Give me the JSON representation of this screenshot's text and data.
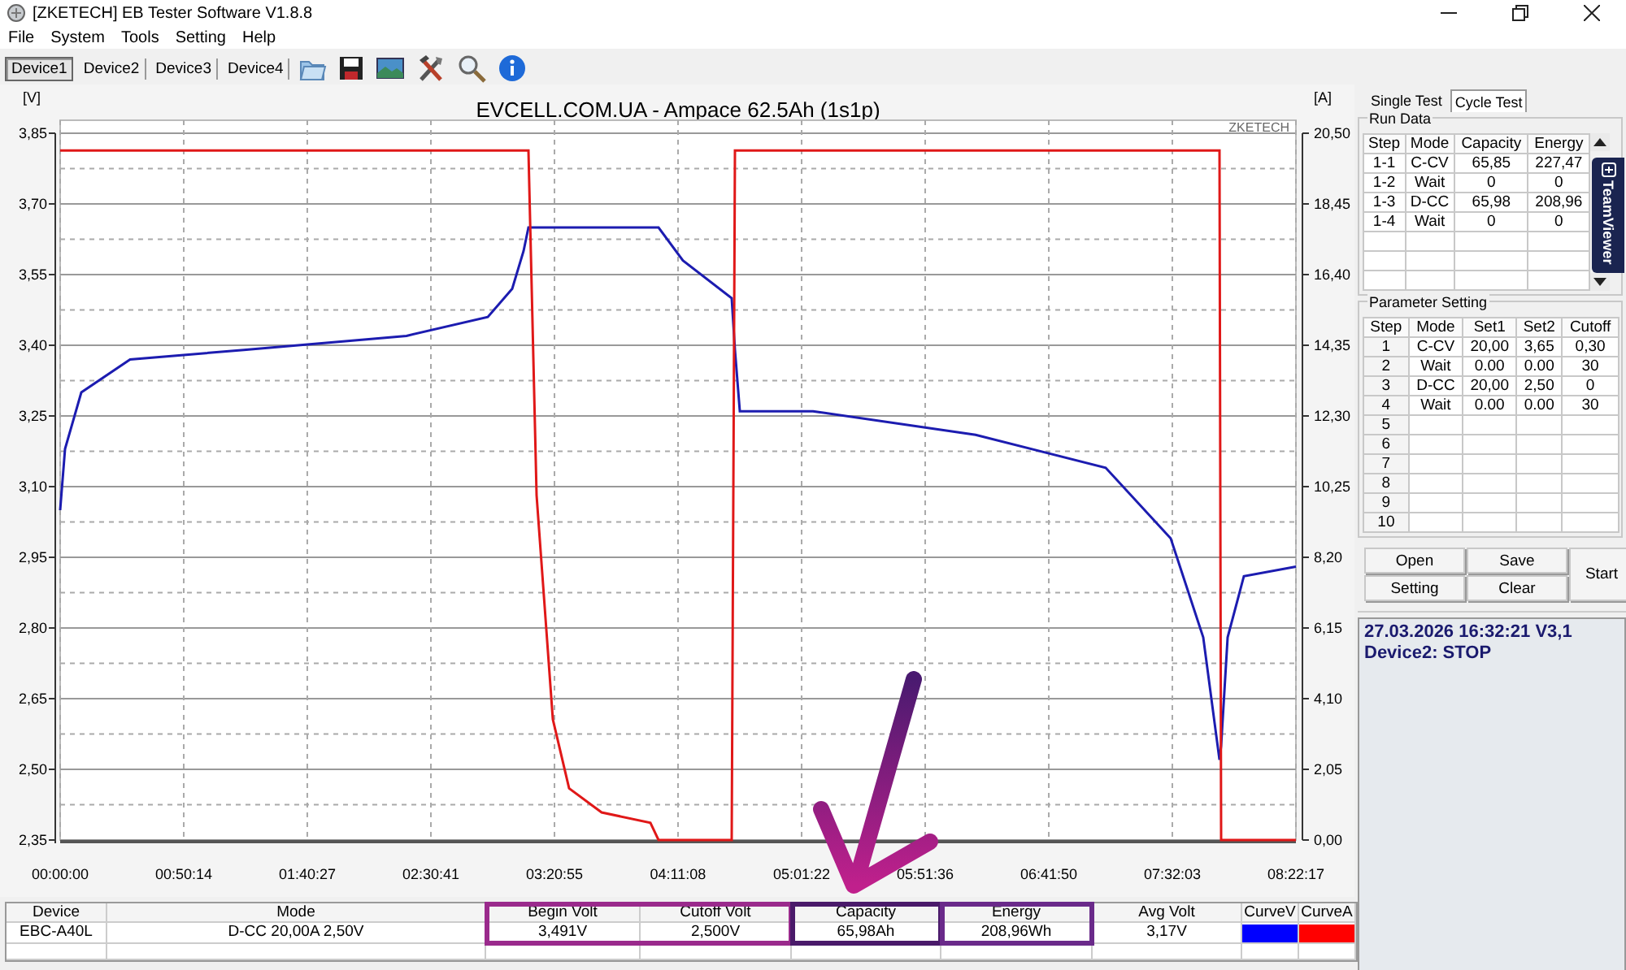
{
  "window": {
    "title": "[ZKETECH] EB Tester Software V1.8.8"
  },
  "menu": [
    "File",
    "System",
    "Tools",
    "Setting",
    "Help"
  ],
  "device_tabs": [
    {
      "label": "Device1",
      "selected": true
    },
    {
      "label": "Device2",
      "selected": false
    },
    {
      "label": "Device3",
      "selected": false
    },
    {
      "label": "Device4",
      "selected": false
    }
  ],
  "toolbar": [
    {
      "kind": "folder"
    },
    {
      "kind": "save"
    },
    {
      "kind": "image"
    },
    {
      "kind": "tools"
    },
    {
      "kind": "search"
    },
    {
      "kind": "info"
    }
  ],
  "chart": {
    "brand_label": "ZKETECH",
    "chart_data": {
      "type": "line",
      "title": "EVCELL.COM.UA - Ampace 62.5Ah (1s1p)",
      "ylabel": "[V]",
      "y2label": "[A]",
      "x": [
        0,
        119,
        516,
        1705,
        4481,
        8446,
        10429,
        11024,
        11301,
        11420,
        11619,
        12015,
        12412,
        13205,
        14394,
        14593,
        15188,
        16377,
        16456,
        16575,
        18360,
        22325,
        25497,
        27084,
        27877,
        28273,
        28313,
        28472,
        28868,
        30137
      ],
      "series": [
        {
          "color": "#1c1cb0",
          "values": [
            3.05,
            3.18,
            3.3,
            3.37,
            3.39,
            3.42,
            3.46,
            3.52,
            3.6,
            3.65,
            3.65,
            3.65,
            3.65,
            3.65,
            3.65,
            3.65,
            3.58,
            3.5,
            3.39,
            3.26,
            3.26,
            3.21,
            3.14,
            2.99,
            2.78,
            2.52,
            2.55,
            2.78,
            2.91,
            2.93
          ]
        },
        {
          "color": "#e01818",
          "axis": "y2",
          "values": [
            20.0,
            20.0,
            20.0,
            20.0,
            20.0,
            20.0,
            20.0,
            20.0,
            20.0,
            20.0,
            10.0,
            3.5,
            1.5,
            0.8,
            0.5,
            0.0,
            0.0,
            0.0,
            20.0,
            20.0,
            20.0,
            20.0,
            20.0,
            20.0,
            20.0,
            20.0,
            0.0,
            0.0,
            0.0,
            0.0
          ]
        }
      ],
      "grid": true,
      "xlim": [
        0,
        30137
      ],
      "ylim": [
        2.35,
        3.85
      ],
      "y2lim": [
        0,
        20.5
      ],
      "xticks": [
        {
          "value": 0,
          "label": "00:00:00"
        },
        {
          "value": 3014,
          "label": "00:50:14"
        },
        {
          "value": 6027,
          "label": "01:40:27"
        },
        {
          "value": 9041,
          "label": "02:30:41"
        },
        {
          "value": 12055,
          "label": "03:20:55"
        },
        {
          "value": 15068,
          "label": "04:11:08"
        },
        {
          "value": 18082,
          "label": "05:01:22"
        },
        {
          "value": 21096,
          "label": "05:51:36"
        },
        {
          "value": 24110,
          "label": "06:41:50"
        },
        {
          "value": 27123,
          "label": "07:32:03"
        },
        {
          "value": 30137,
          "label": "08:22:17"
        }
      ],
      "yticks": [
        {
          "value": 2.35,
          "label": "2,35"
        },
        {
          "value": 2.5,
          "label": "2,50"
        },
        {
          "value": 2.65,
          "label": "2,65"
        },
        {
          "value": 2.8,
          "label": "2,80"
        },
        {
          "value": 2.95,
          "label": "2,95"
        },
        {
          "value": 3.1,
          "label": "3,10"
        },
        {
          "value": 3.25,
          "label": "3,25"
        },
        {
          "value": 3.4,
          "label": "3,40"
        },
        {
          "value": 3.55,
          "label": "3,55"
        },
        {
          "value": 3.7,
          "label": "3,70"
        },
        {
          "value": 3.85,
          "label": "3,85"
        }
      ],
      "y2ticks": [
        {
          "value": 0,
          "label": "0,00"
        },
        {
          "value": 2.05,
          "label": "2,05"
        },
        {
          "value": 4.1,
          "label": "4,10"
        },
        {
          "value": 6.15,
          "label": "6,15"
        },
        {
          "value": 8.2,
          "label": "8,20"
        },
        {
          "value": 10.25,
          "label": "10,25"
        },
        {
          "value": 12.3,
          "label": "12,30"
        },
        {
          "value": 14.35,
          "label": "14,35"
        },
        {
          "value": 16.4,
          "label": "16,40"
        },
        {
          "value": 18.45,
          "label": "18,45"
        },
        {
          "value": 20.5,
          "label": "20,50"
        }
      ]
    }
  },
  "summary_table": {
    "columns": [
      {
        "label": "Device"
      },
      {
        "label": "Mode"
      },
      {
        "label": "Begin Volt",
        "color": "#9a2a8c"
      },
      {
        "label": "Cutoff Volt",
        "color": "#9a2a8c"
      },
      {
        "label": "Capacity",
        "color": "#4a1a6a"
      },
      {
        "label": "Energy",
        "color": "#6a2a8a"
      },
      {
        "label": "Avg Volt"
      },
      {
        "label": "CurveV"
      },
      {
        "label": "CurveA"
      }
    ],
    "row": [
      {
        "kind": "text",
        "text": "EBC-A40L"
      },
      {
        "kind": "text",
        "text": "D-CC  20,00A  2,50V"
      },
      {
        "kind": "text",
        "text": "3,491V"
      },
      {
        "kind": "text",
        "text": "2,500V"
      },
      {
        "kind": "text",
        "text": "65,98Ah"
      },
      {
        "kind": "text",
        "text": "208,96Wh"
      },
      {
        "kind": "text",
        "text": "3,17V"
      },
      {
        "kind": "swatch",
        "color": "#0000ff"
      },
      {
        "kind": "swatch",
        "color": "#ff0000"
      }
    ]
  },
  "panel_tabs": [
    {
      "label": "Single Test",
      "selected": false
    },
    {
      "label": "Cycle Test",
      "selected": true
    }
  ],
  "run_data": {
    "title": "Run Data",
    "columns": [
      "Step",
      "Mode",
      "Capacity",
      "Energy"
    ],
    "rows": [
      [
        "1-1",
        "C-CV",
        "65,85",
        "227,47"
      ],
      [
        "1-2",
        "Wait",
        "0",
        "0"
      ],
      [
        "1-3",
        "D-CC",
        "65,98",
        "208,96"
      ],
      [
        "1-4",
        "Wait",
        "0",
        "0"
      ]
    ]
  },
  "parameter_setting": {
    "title": "Parameter Setting",
    "columns": [
      "Step",
      "Mode",
      "Set1",
      "Set2",
      "Cutoff"
    ],
    "rows": [
      [
        "1",
        "C-CV",
        "20,00",
        "3,65",
        "0,30"
      ],
      [
        "2",
        "Wait",
        "0.00",
        "0.00",
        "30"
      ],
      [
        "3",
        "D-CC",
        "20,00",
        "2,50",
        "0"
      ],
      [
        "4",
        "Wait",
        "0.00",
        "0.00",
        "30"
      ],
      [
        "5"
      ],
      [
        "6"
      ],
      [
        "7"
      ],
      [
        "8"
      ],
      [
        "9"
      ],
      [
        "10"
      ]
    ]
  },
  "buttons": [
    {
      "label": "Open"
    },
    {
      "label": "Save"
    },
    {
      "label": "Start"
    },
    {
      "label": "Setting"
    },
    {
      "label": "Clear"
    }
  ],
  "status": {
    "lines": [
      "27.03.2026 16:32:21  V3,1",
      "Device2: STOP"
    ]
  },
  "side_tab": {
    "label": "TeamViewer"
  }
}
